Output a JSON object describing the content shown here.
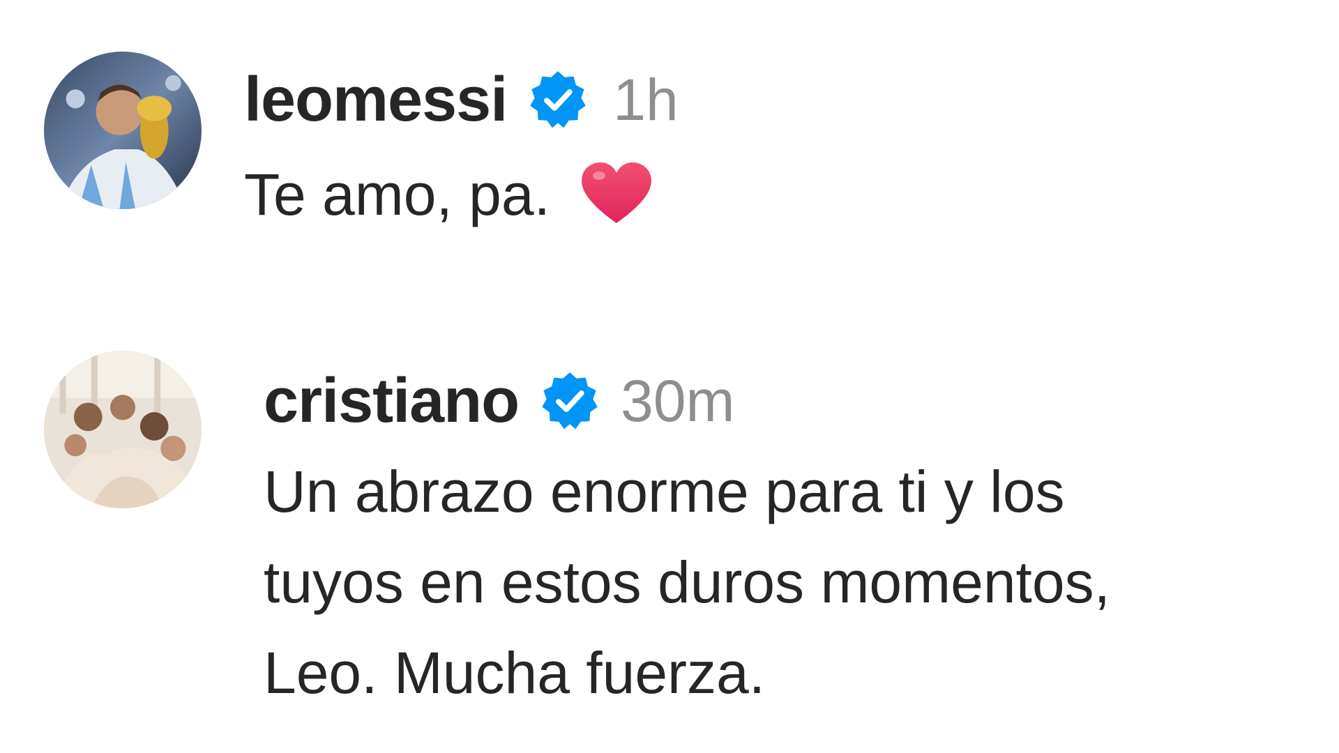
{
  "comments": [
    {
      "username": "leomessi",
      "verified": true,
      "time": "1h",
      "text": "Te amo, pa.",
      "emoji": "red-heart",
      "avatar": "avatar-photo"
    },
    {
      "username": "cristiano",
      "verified": true,
      "time": "30m",
      "text_lines": [
        "Un abrazo enorme para ti y los",
        "tuyos en estos duros momentos,",
        "Leo. Mucha fuerza."
      ],
      "avatar": "avatar-photo"
    }
  ],
  "colors": {
    "text": "#262626",
    "timestamp": "#8e8e8e",
    "verified_badge": "#0095f6",
    "heart": "#e8305a"
  }
}
